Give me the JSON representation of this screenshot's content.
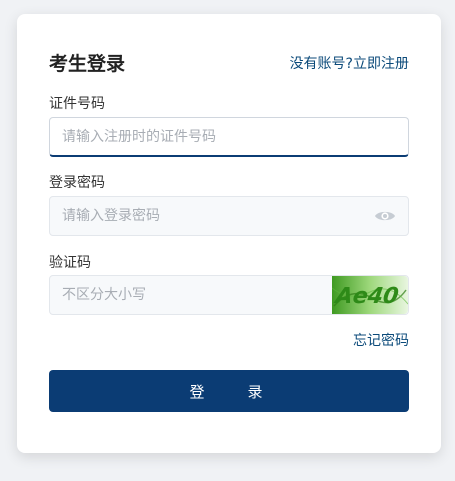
{
  "form": {
    "title": "考生登录",
    "register_link": "没有账号?立即注册",
    "id_label": "证件号码",
    "id_placeholder": "请输入注册时的证件号码",
    "id_value": "",
    "password_label": "登录密码",
    "password_placeholder": "请输入登录密码",
    "password_value": "",
    "password_toggle_icon": "eye-icon",
    "captcha_label": "验证码",
    "captcha_placeholder": "不区分大小写",
    "captcha_value": "",
    "captcha_image_text": "Ae40",
    "forgot_link": "忘记密码",
    "login_button": "登　录"
  },
  "colors": {
    "primary": "#0b3c74",
    "link": "#0b4a7a",
    "captcha_green": "#4fae2c"
  }
}
